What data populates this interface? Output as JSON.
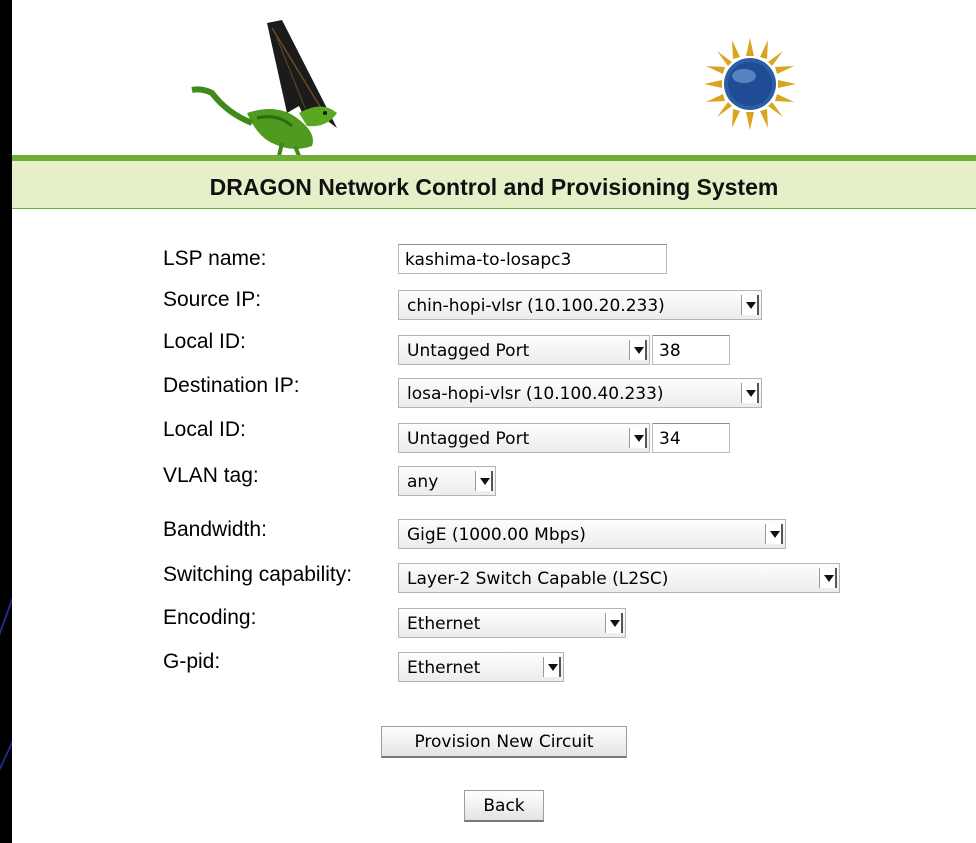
{
  "header": {
    "title": "DRAGON Network Control and Provisioning System"
  },
  "logos": {
    "left": "dragon-logo",
    "right": "nsf-logo"
  },
  "form": {
    "lsp_name": {
      "label": "LSP name:",
      "value": "kashima-to-losapc3"
    },
    "source_ip": {
      "label": "Source IP:",
      "value": "chin-hopi-vlsr (10.100.20.233)"
    },
    "source_local_id": {
      "label": "Local ID:",
      "type": "Untagged Port",
      "value": "38"
    },
    "destination_ip": {
      "label": "Destination IP:",
      "value": "losa-hopi-vlsr (10.100.40.233)"
    },
    "destination_local_id": {
      "label": "Local ID:",
      "type": "Untagged Port",
      "value": "34"
    },
    "vlan_tag": {
      "label": "VLAN tag:",
      "value": "any"
    },
    "bandwidth": {
      "label": "Bandwidth:",
      "value": "GigE (1000.00 Mbps)"
    },
    "switching_capability": {
      "label": "Switching capability:",
      "value": "Layer-2 Switch Capable (L2SC)"
    },
    "encoding": {
      "label": "Encoding:",
      "value": "Ethernet"
    },
    "gpid": {
      "label": "G-pid:",
      "value": "Ethernet"
    }
  },
  "buttons": {
    "provision": "Provision New Circuit",
    "back": "Back"
  }
}
